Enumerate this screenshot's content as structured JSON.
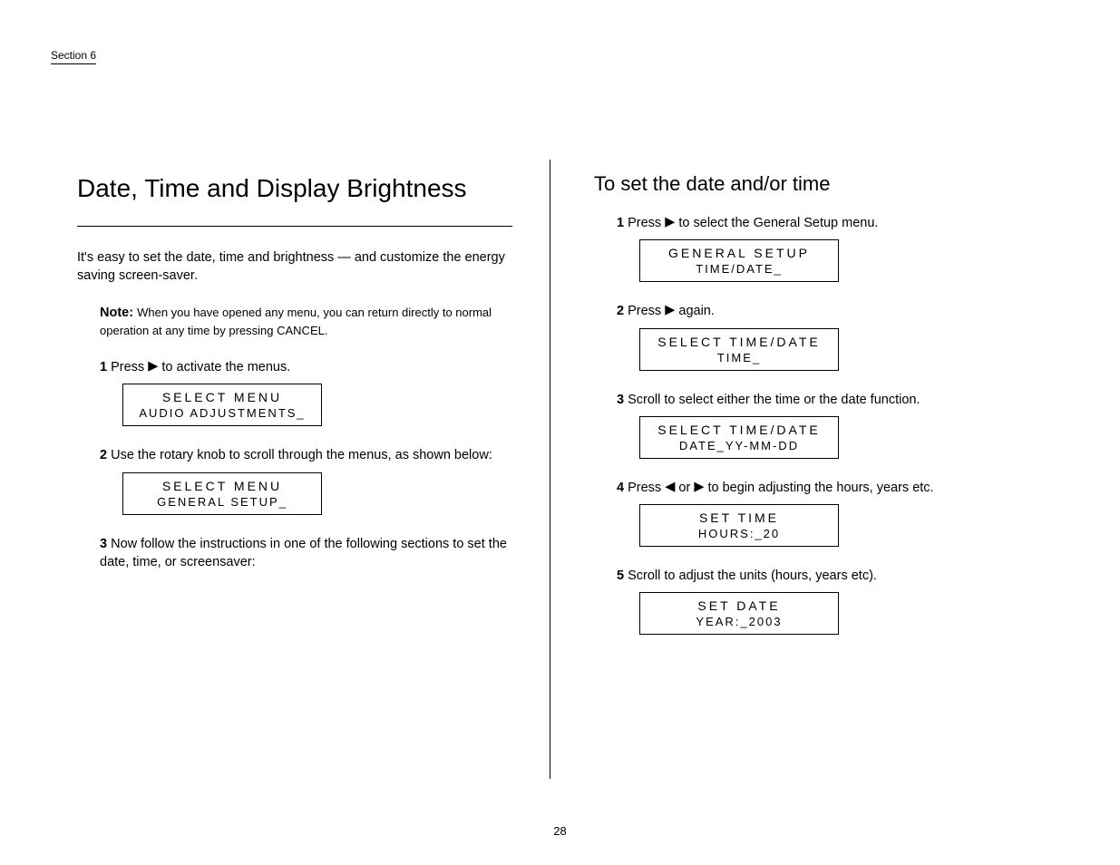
{
  "section": "Section 6",
  "left": {
    "heading": "Date, Time and Display Brightness",
    "intro": "It's easy to set the date, time and brightness — and customize the energy saving screen-saver.",
    "note_label": "Note:",
    "note_text": "When you have opened any menu, you can return directly to normal operation at any time by pressing CANCEL.",
    "s1_num": "1",
    "s1_prefix": "Press ",
    "s1_arrow": "▶",
    "s1_suffix": " to activate the menus.",
    "box1_l1": "SELECT MENU",
    "box1_l2": "AUDIO ADJUSTMENTS_",
    "s2_num": "2",
    "s2_text": "Use the rotary knob to scroll through the menus, as shown below:",
    "box2_l1": "SELECT MENU",
    "box2_l2": "GENERAL SETUP_",
    "s3_num": "3",
    "s3_text": "Now follow the instructions in one of the following sections to set the date, time, or screensaver:"
  },
  "right": {
    "dateHeading": "To set the date and/or time",
    "s1_num": "1",
    "s1_prefix": "Press ",
    "s1_arrow": "▶",
    "s1_suffix": " to select the General Setup menu.",
    "box1_l1": "GENERAL SETUP",
    "box1_l2": "TIME/DATE_",
    "s2_num": "2",
    "s2_prefix": "Press ",
    "s2_arrow": "▶",
    "s2_suffix": " again.",
    "box2_l1": "SELECT TIME/DATE",
    "box2_l2": "TIME_",
    "s3_num": "3",
    "s3_text": "Scroll to select either the time or the date function.",
    "box3_l1": "SELECT TIME/DATE",
    "box3_l2": "DATE_YY-MM-DD",
    "s4_num": "4",
    "s4_prefix": "Press ",
    "s4_al": "◀",
    "s4_or": " or ",
    "s4_ar": "▶",
    "s4_suffix": " to begin adjusting the hours, years etc.",
    "box4_l1": "SET TIME",
    "box4_l2": "HOURS:_20",
    "s5_num": "5",
    "s5_text": "Scroll to adjust the units (hours, years etc).",
    "box5_l1": "SET DATE",
    "box5_l2": "YEAR:_2003"
  },
  "footer": "28"
}
